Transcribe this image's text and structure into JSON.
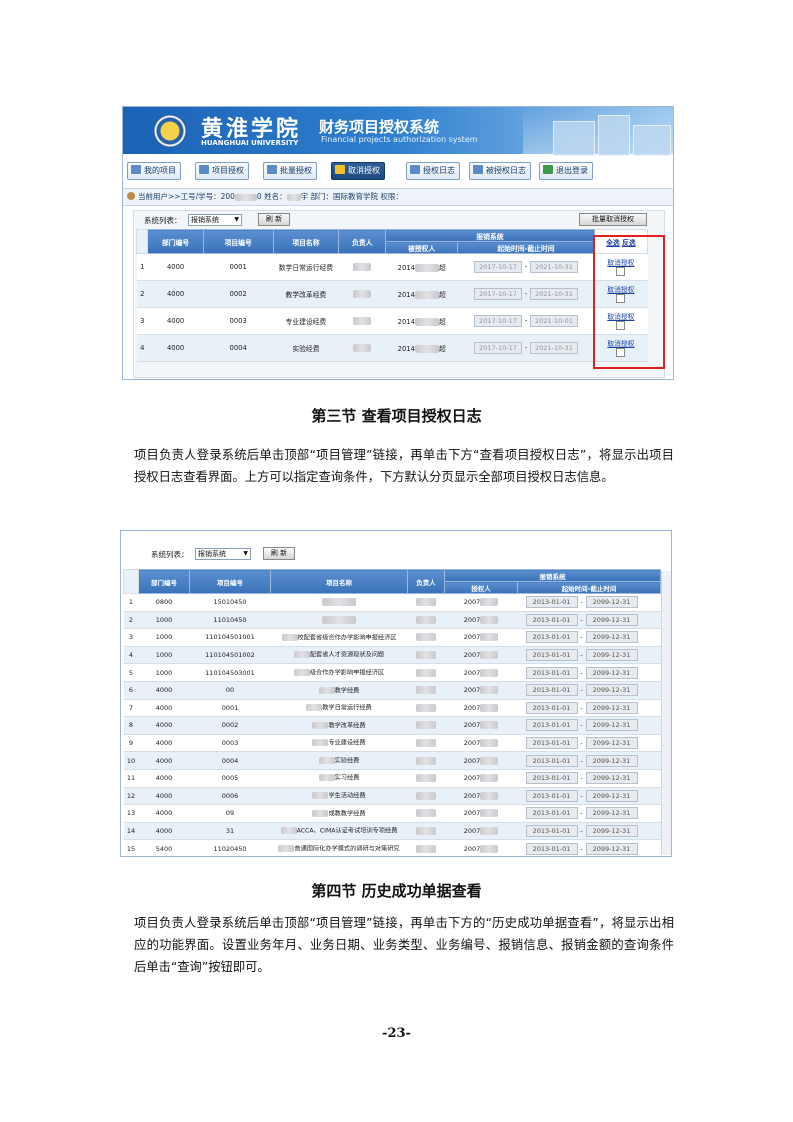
{
  "shot1": {
    "logo_cn": "黄淮学院",
    "logo_en": "HUANGHUAI UNIVERSITY",
    "sys_title": "财务项目授权系统",
    "sys_sub": "Financial projects authorization system",
    "nav": [
      "我的项目",
      "项目授权",
      "批量授权",
      "取消授权",
      "授权日志",
      "被授权日志",
      "退出登录"
    ],
    "active_nav": "取消授权",
    "user_bar": {
      "current_user": "当前用户>>工号/学号：200",
      "name_label": "0 姓名：",
      "name_tail": "宇",
      "dept": "部门：国际教育学院",
      "perm": "权限："
    },
    "filter": {
      "label": "系统列表：",
      "value": "报销系统",
      "refresh": "刷 新",
      "batch_cancel": "批量取消授权"
    },
    "table": {
      "headers": [
        "部门编号",
        "项目编号",
        "项目名称",
        "负责人",
        "报销系统"
      ],
      "sub_headers": [
        "被授权人",
        "起始时间-截止时间"
      ],
      "select_all": "全选",
      "invert": "反选",
      "rows": [
        {
          "idx": "1",
          "dept": "4000",
          "code": "0001",
          "name": "数学日常运行经费",
          "grantee_pre": "2014",
          "grantee_post": "超",
          "start": "2017-10-17",
          "end": "2021-10-31",
          "action": "取消授权"
        },
        {
          "idx": "2",
          "dept": "4000",
          "code": "0002",
          "name": "教学改革经费",
          "grantee_pre": "2014",
          "grantee_post": "超",
          "start": "2017-10-17",
          "end": "2021-10-31",
          "action": "取消授权"
        },
        {
          "idx": "3",
          "dept": "4000",
          "code": "0003",
          "name": "专业建设经费",
          "grantee_pre": "2014",
          "grantee_post": "超",
          "start": "2017-10-17",
          "end": "2021-10-01",
          "action": "取消授权"
        },
        {
          "idx": "4",
          "dept": "4000",
          "code": "0004",
          "name": "实验经费",
          "grantee_pre": "2014",
          "grantee_post": "超",
          "start": "2017-10-17",
          "end": "2021-10-31",
          "action": "取消授权"
        }
      ]
    }
  },
  "section3": {
    "heading": "第三节  查看项目授权日志",
    "paragraph": "项目负责人登录系统后单击顶部“项目管理”链接，再单击下方“查看项目授权日志”，将显示出项目授权日志查看界面。上方可以指定查询条件，下方默认分页显示全部项目授权日志信息。"
  },
  "shot2": {
    "filter": {
      "label": "系统列表：",
      "value": "报销系统",
      "refresh": "刷 新"
    },
    "table": {
      "headers": [
        "部门编号",
        "项目编号",
        "项目名称",
        "负责人",
        "报销系统"
      ],
      "sub_headers": [
        "授权人",
        "起始时间-截止时间"
      ],
      "rows": [
        {
          "idx": "1",
          "dept": "0800",
          "code": "15010450",
          "name": "",
          "grantor": "2007",
          "start": "2013-01-01",
          "end": "2099-12-31"
        },
        {
          "idx": "2",
          "dept": "1000",
          "code": "11010450",
          "name": "",
          "grantor": "2007",
          "start": "2013-01-01",
          "end": "2099-12-31"
        },
        {
          "idx": "3",
          "dept": "1000",
          "code": "110104501001",
          "name": "校配套省级合作办学影响申报经济区",
          "grantor": "2007",
          "start": "2013-01-01",
          "end": "2099-12-31"
        },
        {
          "idx": "4",
          "dept": "1000",
          "code": "110104501002",
          "name": "配套省人才资源现状及问题",
          "grantor": "2007",
          "start": "2013-01-01",
          "end": "2099-12-31"
        },
        {
          "idx": "5",
          "dept": "1000",
          "code": "110104503001",
          "name": "级合作办学影响申报经济区",
          "grantor": "2007",
          "start": "2013-01-01",
          "end": "2099-12-31"
        },
        {
          "idx": "6",
          "dept": "4000",
          "code": "00",
          "name": "教学经费",
          "grantor": "2007",
          "start": "2013-01-01",
          "end": "2099-12-31"
        },
        {
          "idx": "7",
          "dept": "4000",
          "code": "0001",
          "name": "教学日常运行经费",
          "grantor": "2007",
          "start": "2013-01-01",
          "end": "2099-12-31"
        },
        {
          "idx": "8",
          "dept": "4000",
          "code": "0002",
          "name": "教学改革经费",
          "grantor": "2007",
          "start": "2013-01-01",
          "end": "2099-12-31"
        },
        {
          "idx": "9",
          "dept": "4000",
          "code": "0003",
          "name": "专业建设经费",
          "grantor": "2007",
          "start": "2013-01-01",
          "end": "2099-12-31"
        },
        {
          "idx": "10",
          "dept": "4000",
          "code": "0004",
          "name": "实验经费",
          "grantor": "2007",
          "start": "2013-01-01",
          "end": "2099-12-31"
        },
        {
          "idx": "11",
          "dept": "4000",
          "code": "0005",
          "name": "实习经费",
          "grantor": "2007",
          "start": "2013-01-01",
          "end": "2099-12-31"
        },
        {
          "idx": "12",
          "dept": "4000",
          "code": "0006",
          "name": "学生活动经费",
          "grantor": "2007",
          "start": "2013-01-01",
          "end": "2099-12-31"
        },
        {
          "idx": "13",
          "dept": "4000",
          "code": "09",
          "name": "成教教学经费",
          "grantor": "2007",
          "start": "2013-01-01",
          "end": "2099-12-31"
        },
        {
          "idx": "14",
          "dept": "4000",
          "code": "31",
          "name": "ACCA、CIMA认证考试培训专项经费",
          "grantor": "2007",
          "start": "2013-01-01",
          "end": "2099-12-31"
        },
        {
          "idx": "15",
          "dept": "5400",
          "code": "11020450",
          "name": "普通国际化办学模式的调研与对策研究",
          "grantor": "2007",
          "start": "2013-01-01",
          "end": "2099-12-31"
        }
      ]
    }
  },
  "section4": {
    "heading": "第四节  历史成功单据查看",
    "paragraph": "项目负责人登录系统后单击顶部“项目管理”链接，再单击下方的“历史成功单据查看”，将显示出相应的功能界面。设置业务年月、业务日期、业务类型、业务编号、报销信息、报销金额的查询条件后单击“查询”按钮即可。"
  },
  "page_number": "-23-"
}
